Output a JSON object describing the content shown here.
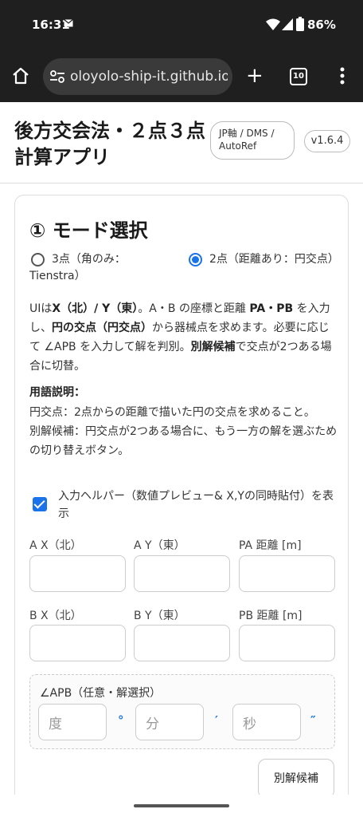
{
  "status": {
    "time": "16:31",
    "battery": "86%",
    "icons": [
      "mail-icon",
      "wifi-icon",
      "signal-icon",
      "battery-icon"
    ]
  },
  "browser": {
    "url": "oloyolo-ship-it.github.io",
    "tab_count": "10",
    "icons": [
      "home-icon",
      "site-settings-icon",
      "plus-icon",
      "tabs-icon",
      "more-icon"
    ]
  },
  "header": {
    "title_line1": "後方交会法・２点３点",
    "title_line2": "計算アプリ",
    "badge_axis": "JP軸 / DMS / AutoRef",
    "badge_version": "v1.6.4"
  },
  "mode": {
    "title": "① モード選択",
    "option1": "3点（角のみ：Tienstra）",
    "option2": "2点（距離あり：円交点）",
    "selected": "option2"
  },
  "description": {
    "p1": "UIは",
    "p2": "X（北）/ Y（東）",
    "p3": "。A・B の座標と距離 ",
    "p4": "PA・PB",
    "p5": " を入力し、",
    "p6": "円の交点（円交点）",
    "p7": "から器械点を求めます。必要に応じて ∠APB を入力して解を判別。",
    "p8": "別解候補",
    "p9": "で交点が2つある場合に切替。"
  },
  "terms": {
    "title": "用語説明：",
    "line1": "円交点：2点からの距離で描いた円の交点を求めること。",
    "line2": "別解候補：円交点が2つある場合に、もう一方の解を選ぶための切り替えボタン。"
  },
  "helper": {
    "label": "入力ヘルパー（数値プレビュー& X,Yの同時貼付）を表示",
    "checked": true
  },
  "fields": {
    "ax": "A X（北）",
    "ay": "A Y（東）",
    "pa": "PA 距離 [m]",
    "bx": "B X（北）",
    "by": "B Y（東）",
    "pb": "PB 距離 [m]"
  },
  "angle": {
    "label": "∠APB（任意・解選択）",
    "deg_placeholder": "度",
    "min_placeholder": "分",
    "sec_placeholder": "秒",
    "deg_unit": "°",
    "min_unit": "′",
    "sec_unit": "″"
  },
  "buttons": {
    "alt": "別解候補"
  },
  "colors": {
    "accent": "#1a73e8",
    "system_bar": "#1f1f1f"
  }
}
